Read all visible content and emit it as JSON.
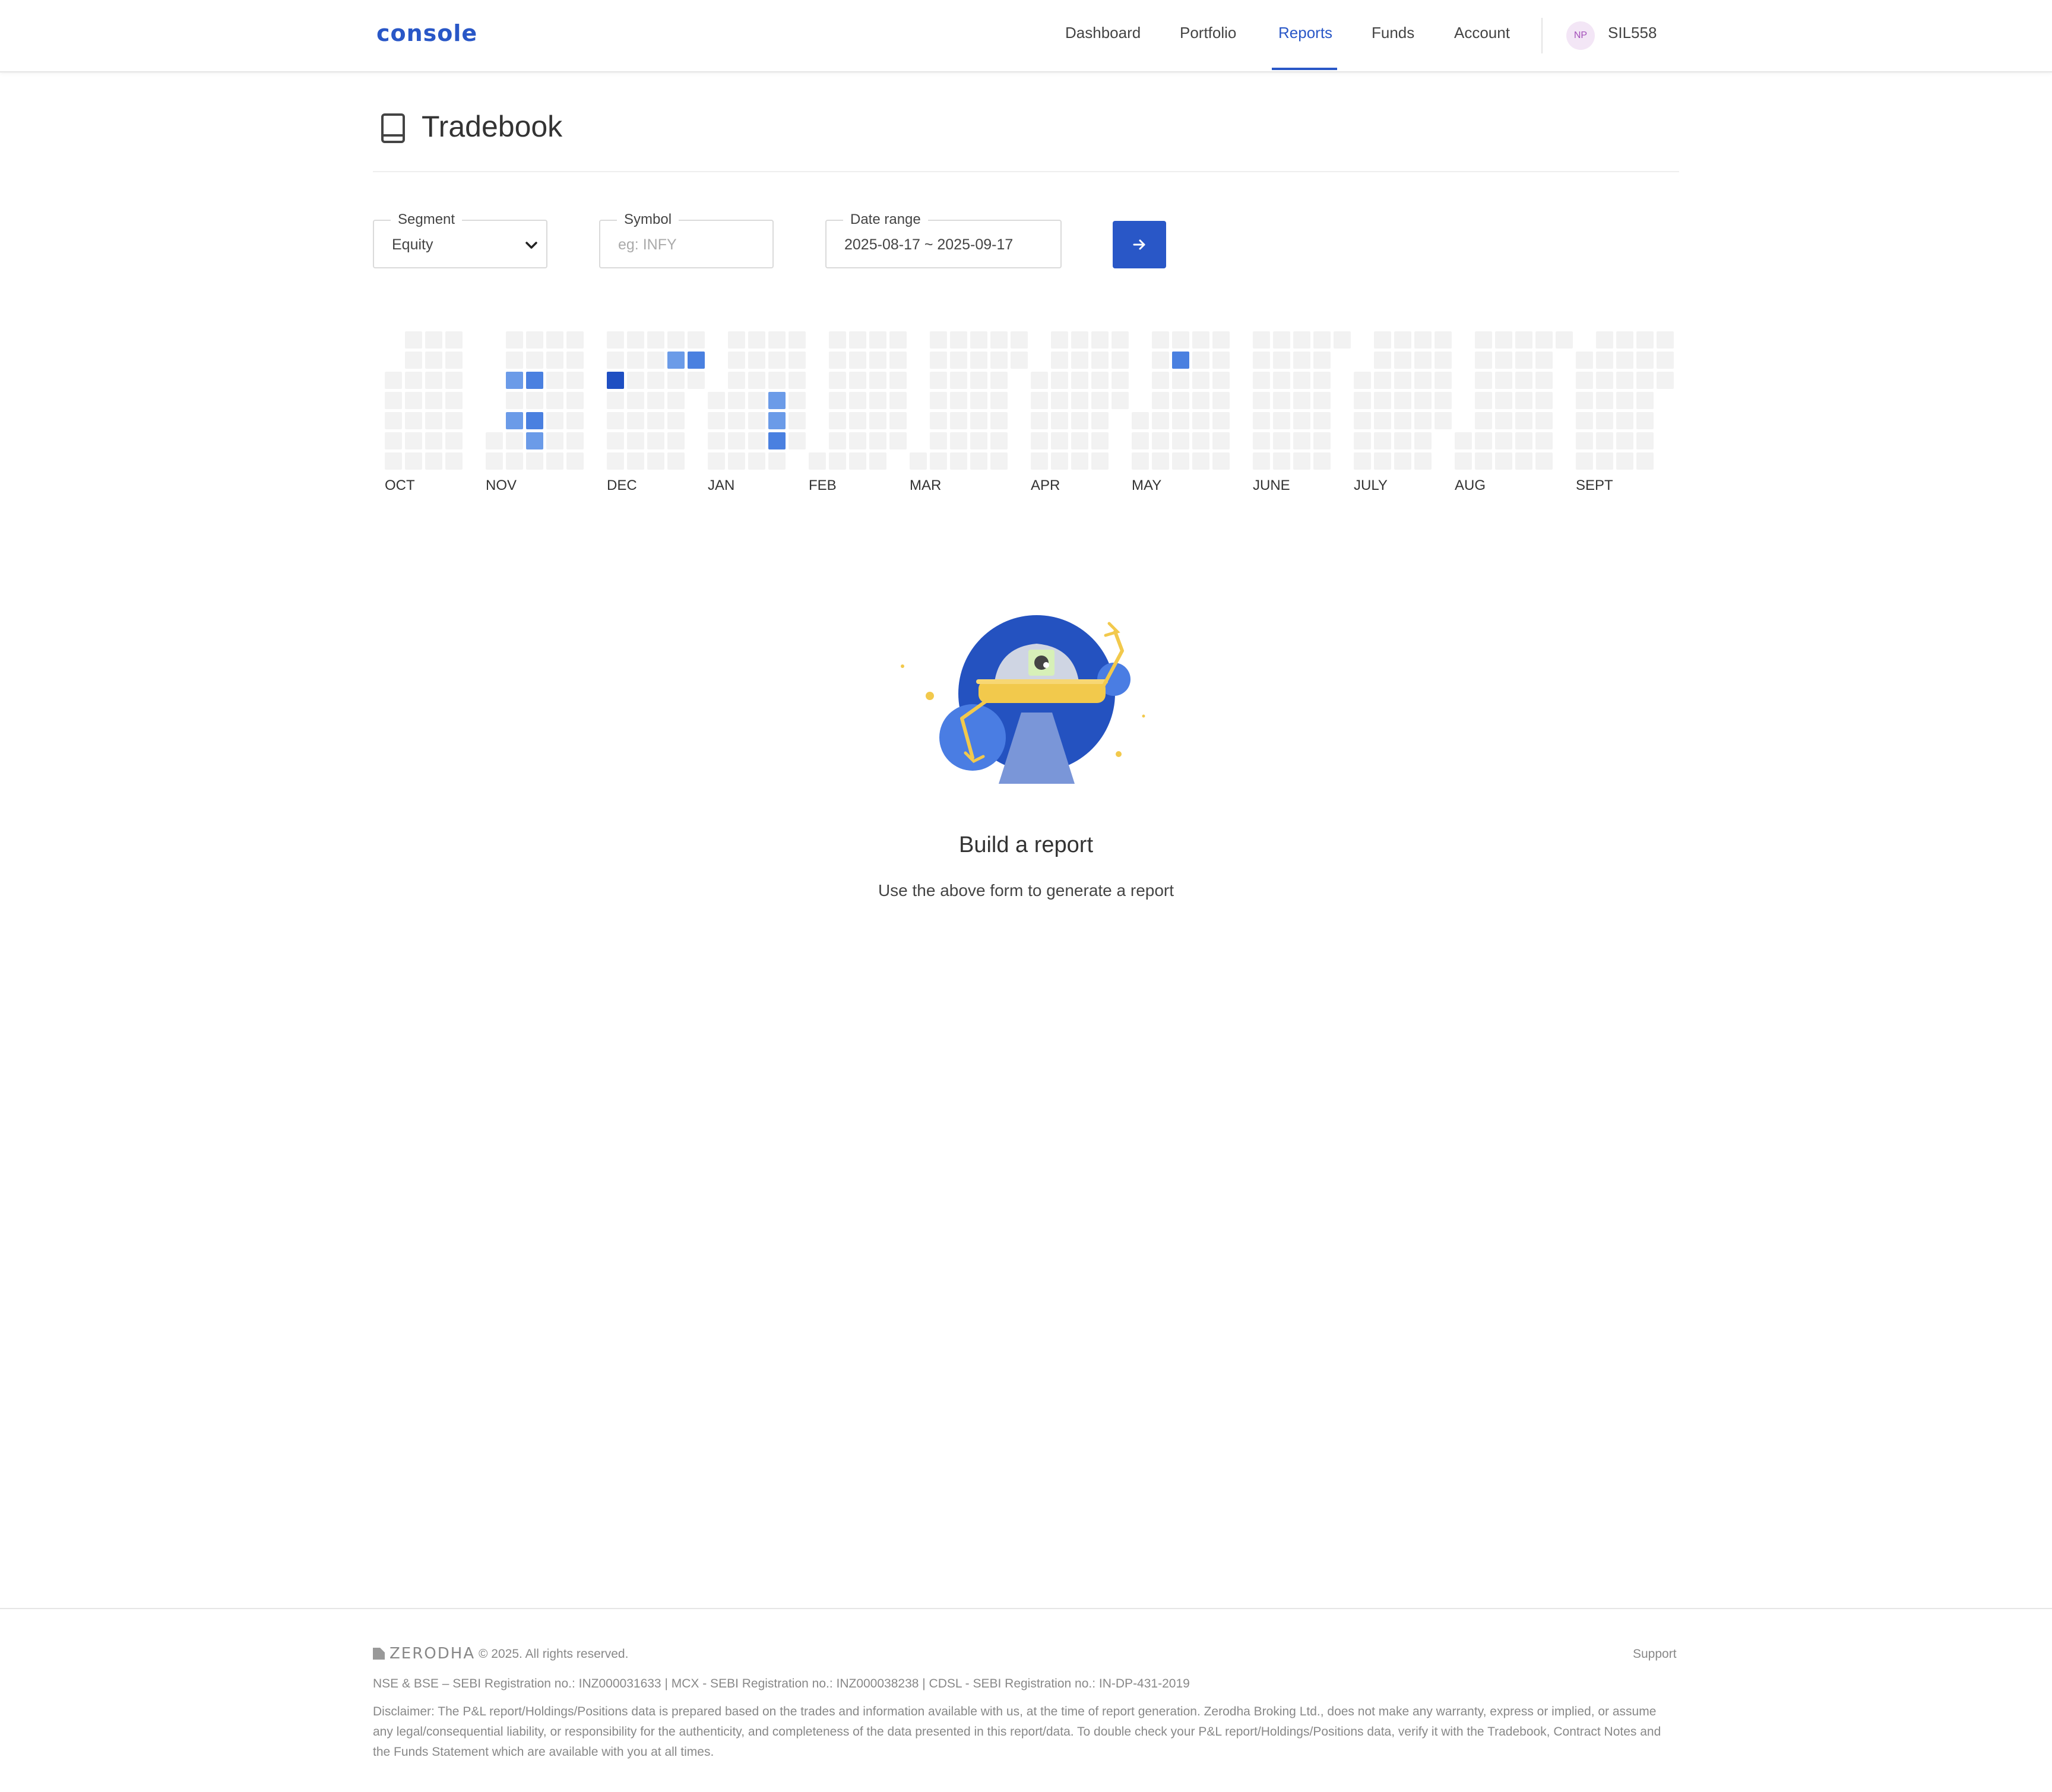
{
  "header": {
    "logo": "console",
    "nav": [
      {
        "label": "Dashboard",
        "active": false
      },
      {
        "label": "Portfolio",
        "active": false
      },
      {
        "label": "Reports",
        "active": true
      },
      {
        "label": "Funds",
        "active": false
      },
      {
        "label": "Account",
        "active": false
      }
    ],
    "avatar_initials": "NP",
    "user_id": "SIL558"
  },
  "page": {
    "title": "Tradebook",
    "title_icon": "book-icon"
  },
  "form": {
    "segment": {
      "label": "Segment",
      "value": "Equity"
    },
    "symbol": {
      "label": "Symbol",
      "placeholder": "eg: INFY",
      "value": ""
    },
    "date_range": {
      "label": "Date range",
      "value": "2025-08-17 ~ 2025-09-17"
    },
    "submit_icon": "arrow-right-icon"
  },
  "heatmap": {
    "months": [
      "OCT",
      "NOV",
      "DEC",
      "JAN",
      "FEB",
      "MAR",
      "APR",
      "MAY",
      "JUNE",
      "JULY",
      "AUG",
      "SEPT"
    ],
    "colors": {
      "empty": "#f2f2f2",
      "low": "#6b9be8",
      "mid": "#4a80e0",
      "high": "#1f4fc2"
    }
  },
  "empty_state": {
    "title": "Build a report",
    "subtitle": "Use the above form to generate a report"
  },
  "footer": {
    "brand": "ZERODHA",
    "copyright": "© 2025. All rights reserved.",
    "support": "Support",
    "registration": "NSE & BSE – SEBI Registration no.: INZ000031633 | MCX - SEBI Registration no.: INZ000038238 | CDSL - SEBI Registration no.: IN-DP-431-2019",
    "disclaimer": "Disclaimer: The P&L report/Holdings/Positions data is prepared based on the trades and information available with us, at the time of report generation. Zerodha Broking Ltd., does not make any warranty, express or implied, or assume any legal/consequential liability, or responsibility for the authenticity, and completeness of the data presented in this report/data. To double check your P&L report/Holdings/Positions data, verify it with the Tradebook, Contract Notes and the Funds Statement which are available with you at all times."
  },
  "colors": {
    "accent": "#2957c7"
  }
}
